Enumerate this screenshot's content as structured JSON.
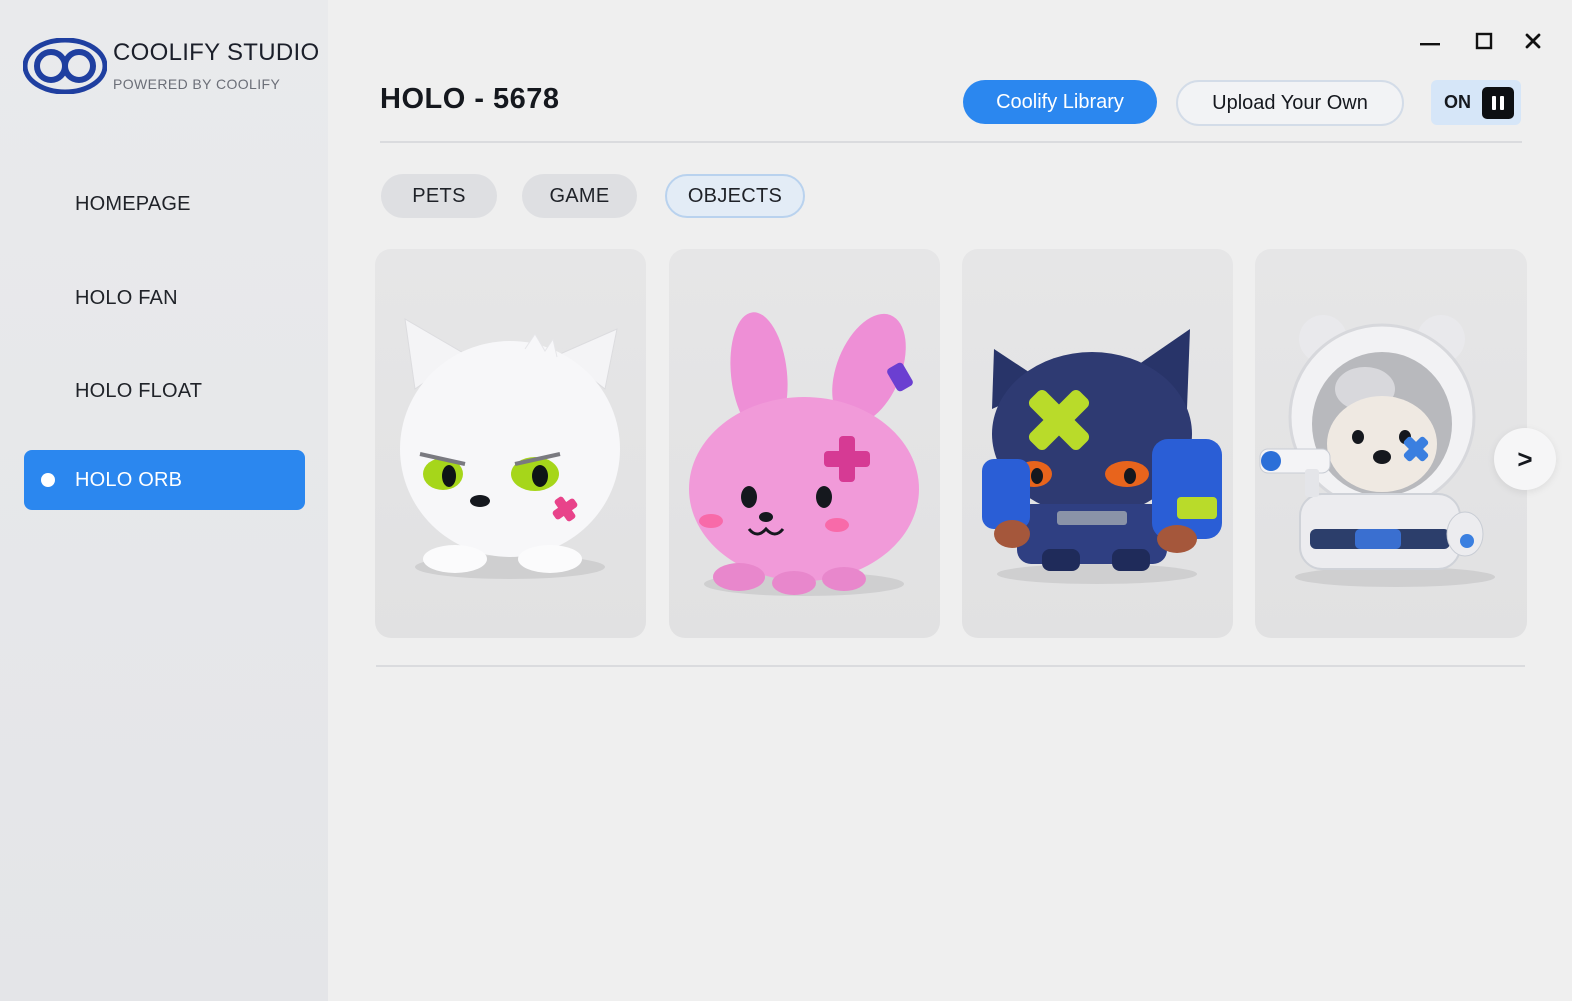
{
  "app": {
    "name": "COOLIFY STUDIO",
    "subtitle": "POWERED BY COOLIFY",
    "logo_icon": "infinity-ring-logo",
    "accent_color": "#2b87ef"
  },
  "window_controls": {
    "minimize_icon": "minimize-icon",
    "maximize_icon": "maximize-icon",
    "close_icon": "close-icon"
  },
  "sidebar": {
    "items": [
      {
        "label": "HOMEPAGE",
        "active": false
      },
      {
        "label": "HOLO FAN",
        "active": false
      },
      {
        "label": "HOLO FLOAT",
        "active": false
      },
      {
        "label": "HOLO ORB",
        "active": true
      }
    ]
  },
  "header": {
    "title": "HOLO - 5678",
    "library_button": "Coolify Library",
    "upload_button": "Upload Your Own",
    "toggle": {
      "label": "ON",
      "icon": "pause-icon"
    }
  },
  "filters": {
    "chips": [
      {
        "label": "PETS",
        "selected": false
      },
      {
        "label": "GAME",
        "selected": false
      },
      {
        "label": "OBJECTS",
        "selected": true
      }
    ]
  },
  "gallery": {
    "cards": [
      {
        "name": "white-wolf-figure"
      },
      {
        "name": "pink-bunny-figure"
      },
      {
        "name": "navy-cat-warrior-figure"
      },
      {
        "name": "astronaut-bear-figure"
      }
    ],
    "next_label": ">"
  }
}
